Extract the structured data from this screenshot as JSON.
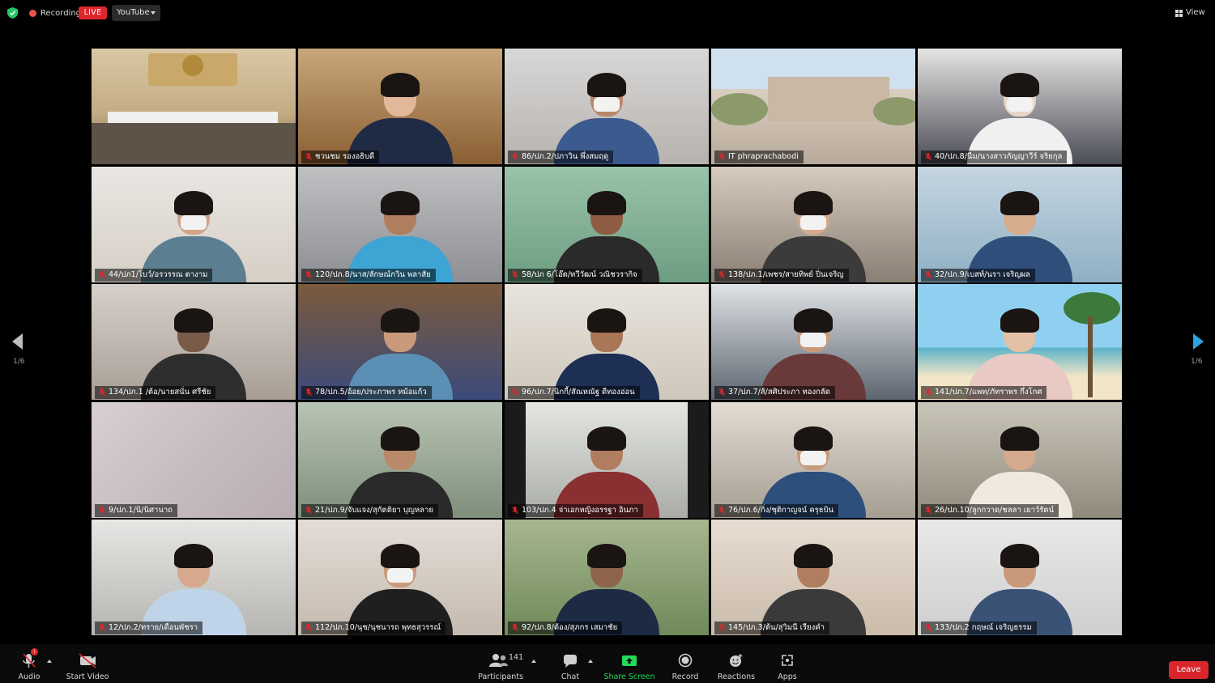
{
  "top_bar": {
    "recording_label": "Recording",
    "live_badge": "LIVE",
    "stream_target": "YouTube",
    "view_label": "View"
  },
  "pagination": {
    "left_indicator": "1/6",
    "right_indicator": "1/6"
  },
  "participants": [
    {
      "name": "",
      "kind": "room",
      "colors": [
        "#d9c7a5",
        "#c4ad84",
        "#7b6a52"
      ]
    },
    {
      "name": "ชวนชม รองอธิบดี",
      "kind": "person",
      "colors": [
        "#c8a77a",
        "#8b5e34",
        "#1f2a44",
        "#e2b89a"
      ]
    },
    {
      "name": "86/ปภ.2/ปภาวิน พึ่งสมฤดู",
      "kind": "person",
      "mask": true,
      "colors": [
        "#d8d8d8",
        "#b7b2ad",
        "#3b5a8f",
        "#b9876a"
      ]
    },
    {
      "name": "IT phraprachabodi",
      "kind": "outdoor",
      "colors": [
        "#cfe0ef",
        "#8c9a6b",
        "#d9cfc0",
        "#b8a99a"
      ]
    },
    {
      "name": "40/ปภ.8/นีม/นางสาวกัญญาวีร์ จริยกุล",
      "kind": "person",
      "mask": true,
      "colors": [
        "#e6e4e2",
        "#4a4c57",
        "#f0f0f0",
        "#e9d6c9"
      ]
    },
    {
      "name": "44/ปภ1/โบว์/อรวรรณ ตางาม",
      "kind": "person",
      "mask": true,
      "colors": [
        "#e9e6e2",
        "#d6cfc6",
        "#5b7f90",
        "#cfa48a"
      ]
    },
    {
      "name": "120/ปภ.8/นาส/ลักษณ์กวิน พลาสัย",
      "kind": "person",
      "colors": [
        "#bfc0c2",
        "#8d8f93",
        "#3da4d4",
        "#b07e5e"
      ]
    },
    {
      "name": "58/ปภ 6/โอ๊ต/ทวีวัฒน์ วณิชวรากิจ",
      "kind": "person",
      "colors": [
        "#9ac3a9",
        "#6d9e82",
        "#2a2a2a",
        "#8e5d44"
      ]
    },
    {
      "name": "138/ปภ.1/เพชร/สายทิพย์ ปิ่นเจริญ",
      "kind": "person",
      "mask": true,
      "colors": [
        "#d7cbbf",
        "#8a7f74",
        "#3b3b3b",
        "#d6a98f"
      ]
    },
    {
      "name": "32/ปภ.9/เบสท์/นรา เจริญผล",
      "kind": "person",
      "colors": [
        "#c5d5e0",
        "#8fb0c4",
        "#2f4f7a",
        "#d7ad8e"
      ]
    },
    {
      "name": "134/ปภ.1 /ต้อ/นายสนั่น ศรีชัย",
      "kind": "person",
      "colors": [
        "#d6d0ca",
        "#a89e96",
        "#2e2e2e",
        "#7a5a48"
      ]
    },
    {
      "name": "78/ปภ.5/อ้อย/ประภาพร หม้อแก้ว",
      "kind": "person",
      "colors": [
        "#7b5a3c",
        "#3c4a7a",
        "#5b8fb3",
        "#c99a7a"
      ]
    },
    {
      "name": "96/ปภ.7/นิกกี้/สัณหณัฐ ดีทองอ่อน",
      "kind": "person",
      "colors": [
        "#e8e4dd",
        "#cfc7bb",
        "#1e2f55",
        "#a97656"
      ]
    },
    {
      "name": "37/ปภ.7/ส้/สศิประภา ทองกลัด",
      "kind": "person",
      "mask": true,
      "colors": [
        "#dfe3e6",
        "#5d6670",
        "#6a3a3a",
        "#c99a7a"
      ]
    },
    {
      "name": "141/ปภ.7/แพท/ภัทราพร กึ่งโกศ",
      "kind": "beach",
      "colors": [
        "#8fd0f0",
        "#f2e6c8",
        "#3c7a3c",
        "#e4c0a4"
      ]
    },
    {
      "name": "9/ปภ.1/นิ/นิศานาถ",
      "kind": "blank",
      "colors": [
        "#d8cfd4",
        "#c6bcc1",
        "#b9adb3",
        "#a89ca2"
      ]
    },
    {
      "name": "21/ปภ.9/จับแจง/สุกัตติยา บุญหลาย",
      "kind": "person",
      "colors": [
        "#b9c4b4",
        "#7f8f7b",
        "#2a2a2a",
        "#b88a6a"
      ]
    },
    {
      "name": "103/ปภ.4 จ่าเอกหญิงอรรฐา อินภา",
      "kind": "person",
      "inset": true,
      "colors": [
        "#e4e6e2",
        "#a9aca6",
        "#8a2f32",
        "#b07d60"
      ]
    },
    {
      "name": "76/ปภ.6/กิ่ง/ชุติกาญจน์ ครุธบิน",
      "kind": "person",
      "mask": true,
      "colors": [
        "#e2dcd4",
        "#a69e92",
        "#2d4f7c",
        "#c99a7a"
      ]
    },
    {
      "name": "26/ปภ.10/ลูกกวาด/ชลลา เยาว์รัตน์",
      "kind": "person",
      "colors": [
        "#c9c5b8",
        "#8f8a7c",
        "#efe9df",
        "#d4a98d"
      ]
    },
    {
      "name": "12/ปภ.2/ทราย/เดือนพัชรา",
      "kind": "person",
      "colors": [
        "#e6e6e4",
        "#b6b5b2",
        "#bfd4e8",
        "#d6a98f"
      ]
    },
    {
      "name": "112/ปภ.10/นุช/นุชนารถ พุทธสุวรรณ์",
      "kind": "person",
      "mask": true,
      "colors": [
        "#e4ddd6",
        "#c5bab0",
        "#1f1f1f",
        "#c99a7a"
      ]
    },
    {
      "name": "92/ปภ.8/ต้อง/สุภกร เสมาชัย",
      "kind": "person",
      "colors": [
        "#a7b68f",
        "#6f8a5a",
        "#1c2a44",
        "#8e644c"
      ]
    },
    {
      "name": "145/ปภ.3/ต้น/สุวิมนี เรียงคำ",
      "kind": "person",
      "colors": [
        "#e7ddd2",
        "#cbbcab",
        "#3a3a3a",
        "#b07d60"
      ]
    },
    {
      "name": "133/ปภ.2 กฤษณ์ เจริญธรรม",
      "kind": "person",
      "colors": [
        "#e8e8e8",
        "#cfcfcf",
        "#3b5277",
        "#c99a7a"
      ]
    }
  ],
  "toolbar": {
    "audio": {
      "label": "Audio",
      "badge": "!"
    },
    "video": {
      "label": "Start Video"
    },
    "participants": {
      "label": "Participants",
      "count": "141"
    },
    "chat": {
      "label": "Chat"
    },
    "share": {
      "label": "Share Screen",
      "color": "#23d959"
    },
    "record": {
      "label": "Record"
    },
    "reactions": {
      "label": "Reactions"
    },
    "apps": {
      "label": "Apps"
    },
    "leave": {
      "label": "Leave",
      "color": "#d8262c"
    }
  }
}
